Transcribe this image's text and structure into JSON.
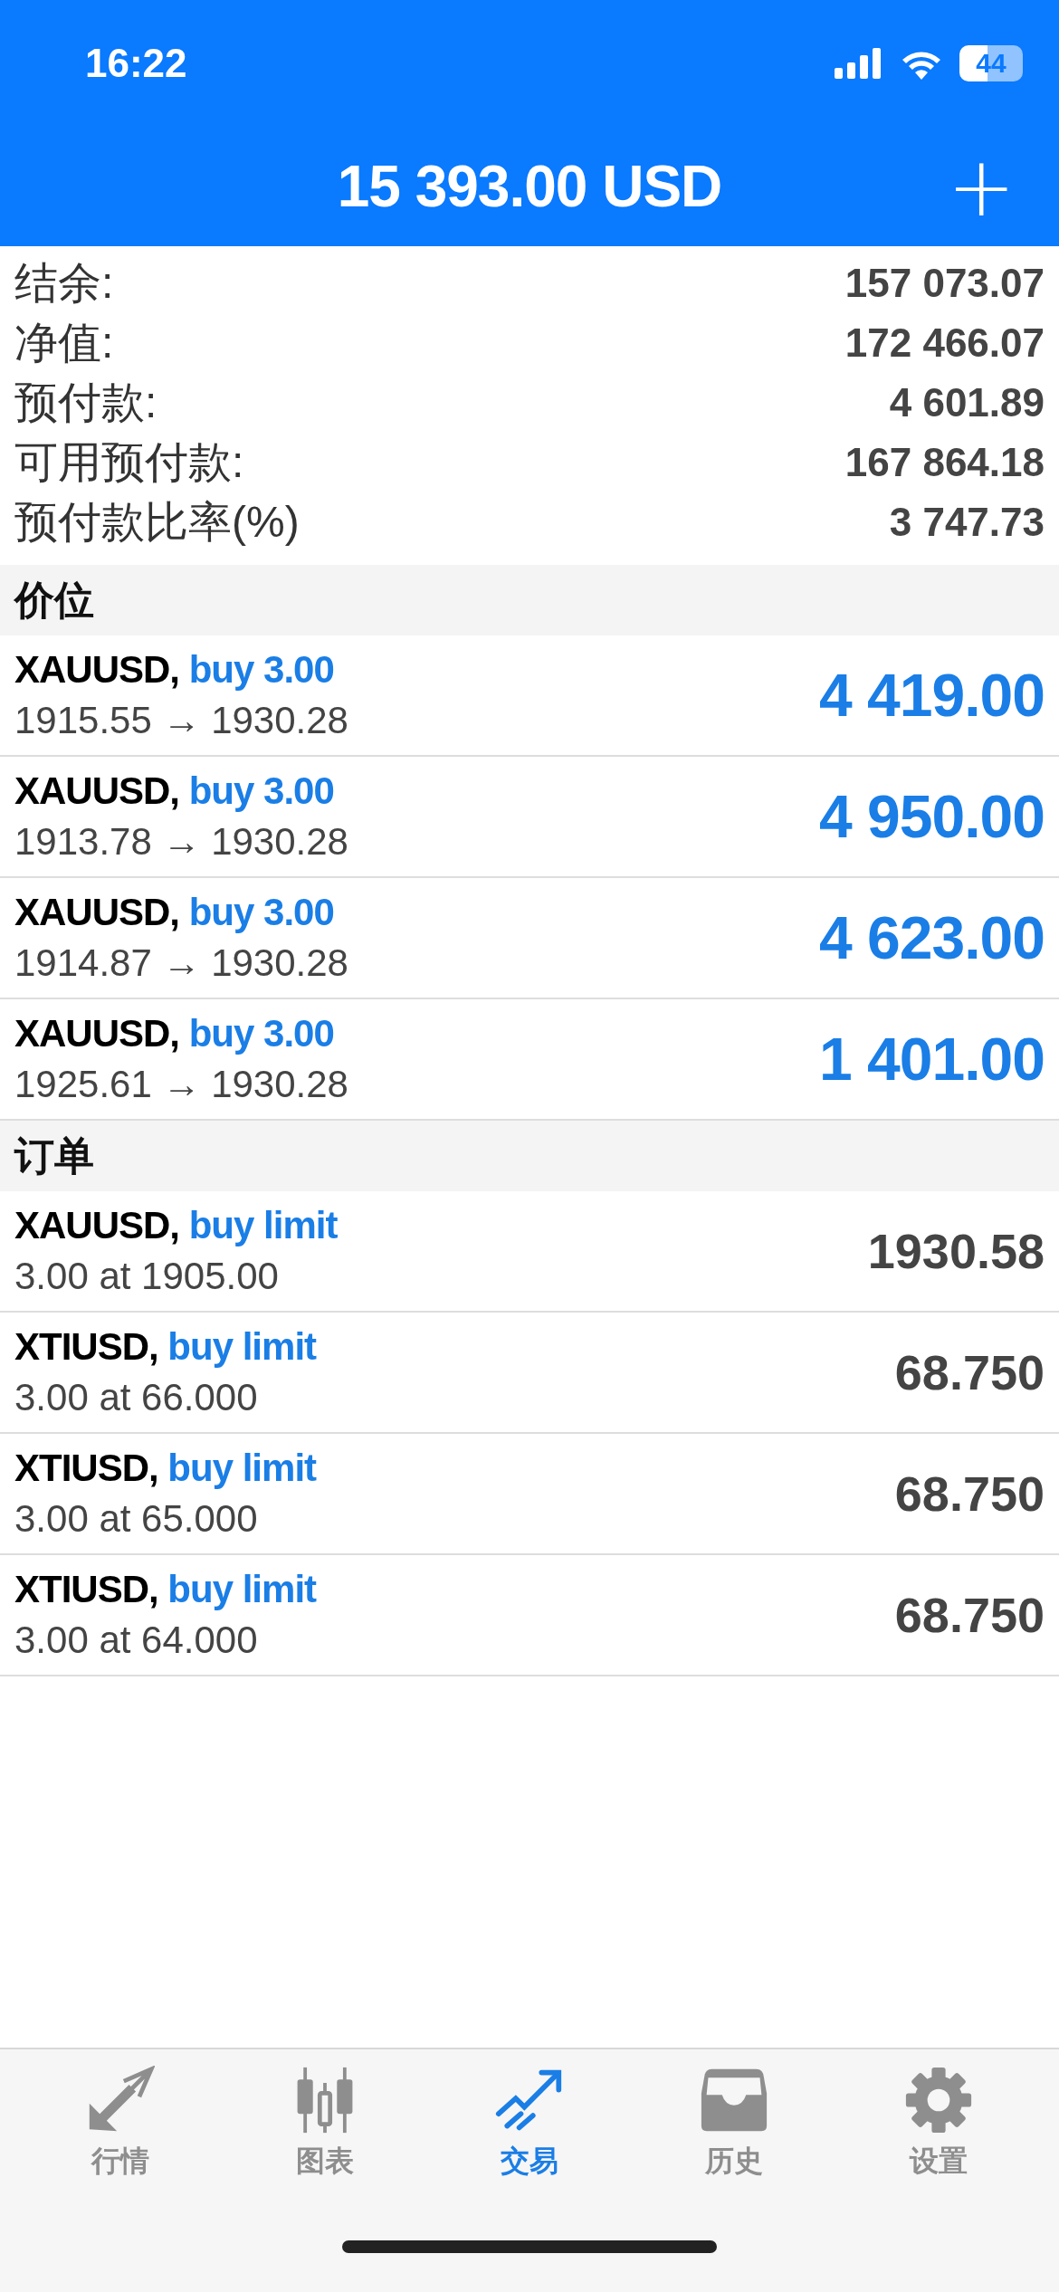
{
  "status_bar": {
    "time": "16:22",
    "battery": "44"
  },
  "header": {
    "title": "15 393.00 USD",
    "add_icon": "+"
  },
  "summary": [
    {
      "label": "结余:",
      "value": "157 073.07"
    },
    {
      "label": "净值:",
      "value": "172 466.07"
    },
    {
      "label": "预付款:",
      "value": "4 601.89"
    },
    {
      "label": "可用预付款:",
      "value": "167 864.18"
    },
    {
      "label": "预付款比率(%)",
      "value": "3 747.73"
    }
  ],
  "positions": {
    "title": "价位",
    "items": [
      {
        "symbol": "XAUUSD,",
        "side": "buy 3.00",
        "prices": "1915.55 → 1930.28",
        "profit": "4 419.00"
      },
      {
        "symbol": "XAUUSD,",
        "side": "buy 3.00",
        "prices": "1913.78 → 1930.28",
        "profit": "4 950.00"
      },
      {
        "symbol": "XAUUSD,",
        "side": "buy 3.00",
        "prices": "1914.87 → 1930.28",
        "profit": "4 623.00"
      },
      {
        "symbol": "XAUUSD,",
        "side": "buy 3.00",
        "prices": "1925.61 → 1930.28",
        "profit": "1 401.00"
      }
    ]
  },
  "orders": {
    "title": "订单",
    "items": [
      {
        "symbol": "XAUUSD,",
        "side": "buy limit",
        "detail": "3.00 at 1905.00",
        "price": "1930.58"
      },
      {
        "symbol": "XTIUSD,",
        "side": "buy limit",
        "detail": "3.00 at 66.000",
        "price": "68.750"
      },
      {
        "symbol": "XTIUSD,",
        "side": "buy limit",
        "detail": "3.00 at 65.000",
        "price": "68.750"
      },
      {
        "symbol": "XTIUSD,",
        "side": "buy limit",
        "detail": "3.00 at 64.000",
        "price": "68.750"
      }
    ]
  },
  "tab_bar": [
    {
      "kind": "quotes",
      "label": "行情",
      "selected": false
    },
    {
      "kind": "chart",
      "label": "图表",
      "selected": false
    },
    {
      "kind": "trade",
      "label": "交易",
      "selected": true
    },
    {
      "kind": "history",
      "label": "历史",
      "selected": false
    },
    {
      "kind": "settings",
      "label": "设置",
      "selected": false
    }
  ]
}
